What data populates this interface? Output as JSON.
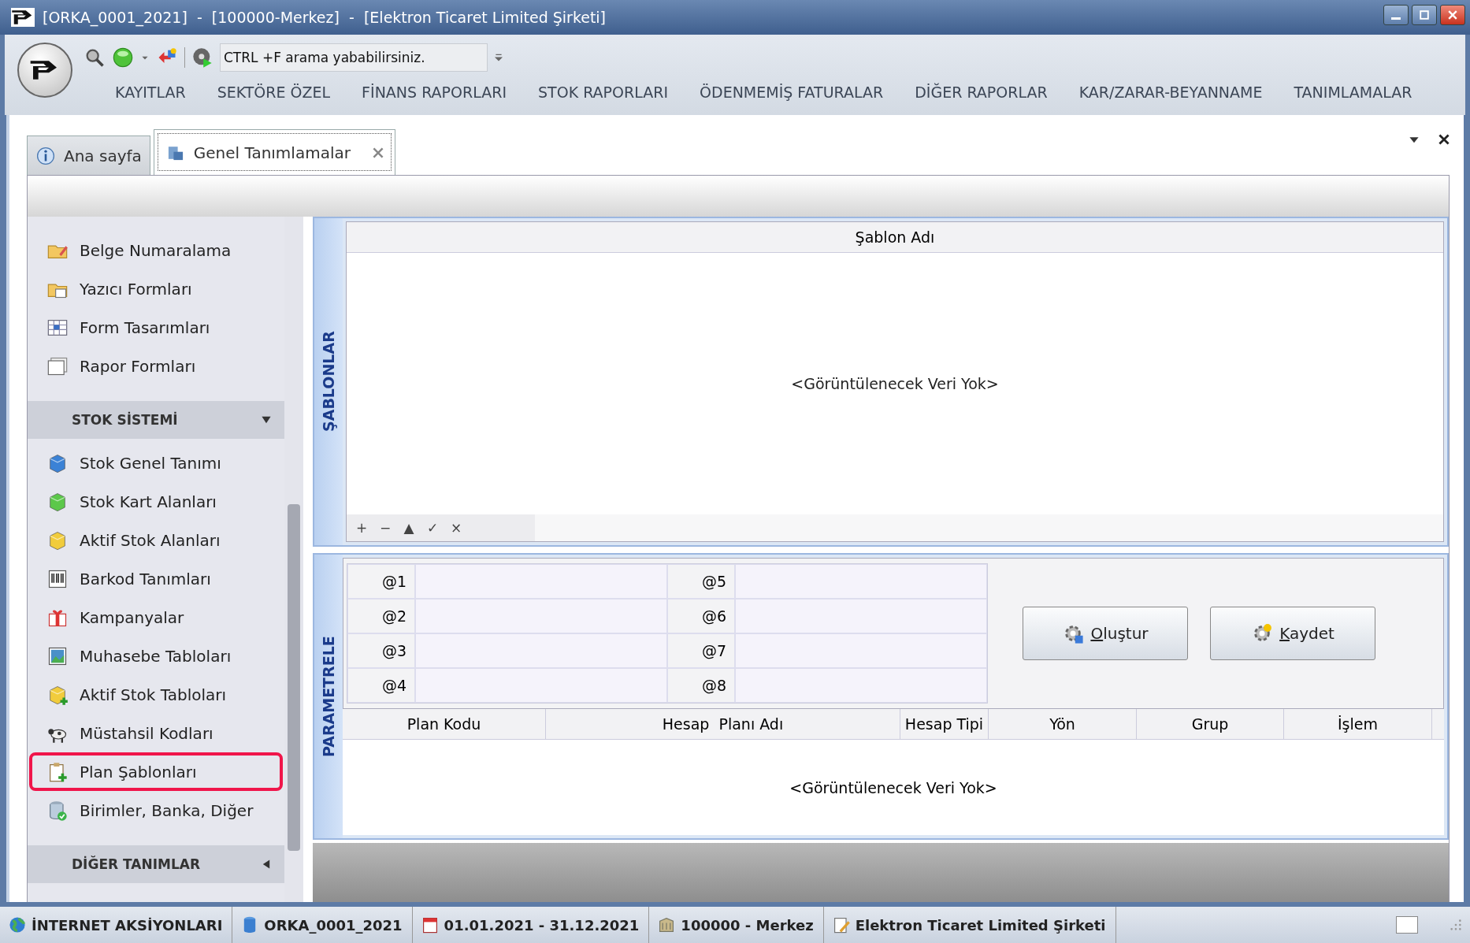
{
  "window": {
    "title": "[ORKA_0001_2021]  -  [100000-Merkez]  -  [Elektron Ticaret Limited Şirketi]"
  },
  "quick_access": {
    "search": {
      "placeholder": "CTRL +F arama yababilirsiniz."
    }
  },
  "ribbon_tabs": [
    {
      "label": "KAYITLAR"
    },
    {
      "label": "SEKTÖRE ÖZEL"
    },
    {
      "label": "FİNANS RAPORLARI"
    },
    {
      "label": "STOK RAPORLARI"
    },
    {
      "label": "ÖDENMEMİŞ FATURALAR"
    },
    {
      "label": "DİĞER RAPORLAR"
    },
    {
      "label": "KAR/ZARAR-BEYANNAME"
    },
    {
      "label": "TANIMLAMALAR"
    }
  ],
  "doc_tabs": [
    {
      "label": "Ana sayfa",
      "selected": false,
      "closable": false
    },
    {
      "label": "Genel Tanımlamalar",
      "selected": true,
      "closable": true
    }
  ],
  "sidebar": {
    "groups": [
      {
        "items": [
          {
            "label": "Belge Numaralama",
            "highlighted": false
          },
          {
            "label": "Yazıcı Formları",
            "highlighted": false
          },
          {
            "label": "Form Tasarımları",
            "highlighted": false
          },
          {
            "label": "Rapor Formları",
            "highlighted": false
          }
        ]
      },
      {
        "title": "STOK SİSTEMİ",
        "expanded": true,
        "items": [
          {
            "label": "Stok Genel Tanımı",
            "highlighted": false
          },
          {
            "label": "Stok Kart Alanları",
            "highlighted": false
          },
          {
            "label": "Aktif Stok Alanları",
            "highlighted": false
          },
          {
            "label": "Barkod Tanımları",
            "highlighted": false
          },
          {
            "label": "Kampanyalar",
            "highlighted": false
          },
          {
            "label": "Muhasebe Tabloları",
            "highlighted": false
          },
          {
            "label": "Aktif Stok Tabloları",
            "highlighted": false
          },
          {
            "label": "Müstahsil Kodları",
            "highlighted": false
          },
          {
            "label": "Plan Şablonları",
            "highlighted": true
          },
          {
            "label": "Birimler, Banka, Diğer",
            "highlighted": false
          }
        ]
      },
      {
        "title": "DİĞER TANIMLAR",
        "expanded": false
      }
    ]
  },
  "templates": {
    "title": "ŞABLONLAR",
    "column": "Şablon Adı",
    "empty": "<Görüntülenecek Veri Yok>",
    "navigator": [
      "+",
      "−",
      "▲",
      "✓",
      "×"
    ]
  },
  "parameters": {
    "title": "PARAMETRELE",
    "fields": [
      {
        "label": "@1"
      },
      {
        "label": "@2"
      },
      {
        "label": "@3"
      },
      {
        "label": "@4"
      },
      {
        "label": "@5"
      },
      {
        "label": "@6"
      },
      {
        "label": "@7"
      },
      {
        "label": "@8"
      }
    ],
    "buttons": [
      {
        "label": "Oluştur"
      },
      {
        "label": "Kaydet"
      }
    ]
  },
  "plan_table": {
    "columns": [
      "Plan Kodu",
      "Hesap  Planı Adı",
      "Hesap Tipi",
      "Yön",
      "Grup",
      "İşlem"
    ],
    "empty": "<Görüntülenecek Veri Yok>"
  },
  "status_bar": [
    {
      "text": "İNTERNET AKSİYONLARI"
    },
    {
      "text": "ORKA_0001_2021"
    },
    {
      "text": "01.01.2021 - 31.12.2021"
    },
    {
      "text": "100000 - Merkez"
    },
    {
      "text": "Elektron Ticaret Limited Şirketi"
    }
  ]
}
